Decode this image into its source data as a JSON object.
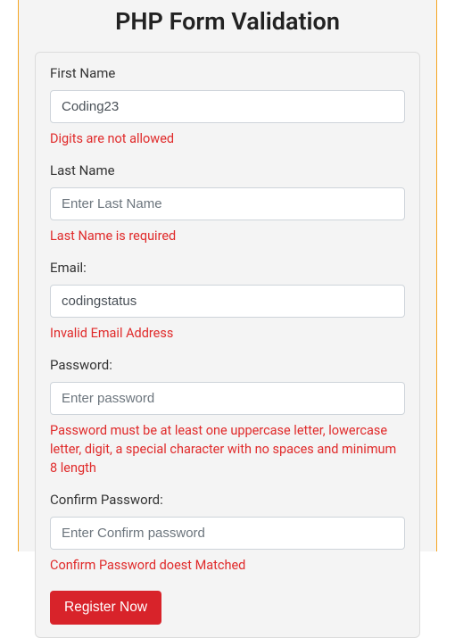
{
  "title": "PHP Form Validation",
  "fields": {
    "firstName": {
      "label": "First Name",
      "value": "Coding23",
      "placeholder": "",
      "error": "Digits are not allowed"
    },
    "lastName": {
      "label": "Last Name",
      "value": "",
      "placeholder": "Enter Last Name",
      "error": "Last Name is required"
    },
    "email": {
      "label": "Email:",
      "value": "codingstatus",
      "placeholder": "",
      "error": "Invalid Email Address"
    },
    "password": {
      "label": "Password:",
      "value": "",
      "placeholder": "Enter password",
      "error": "Password must be at least one uppercase letter, lowercase letter, digit, a special character with no spaces and minimum 8 length"
    },
    "confirmPassword": {
      "label": "Confirm Password:",
      "value": "",
      "placeholder": "Enter Confirm password",
      "error": "Confirm Password doest Matched"
    }
  },
  "submitLabel": "Register Now"
}
